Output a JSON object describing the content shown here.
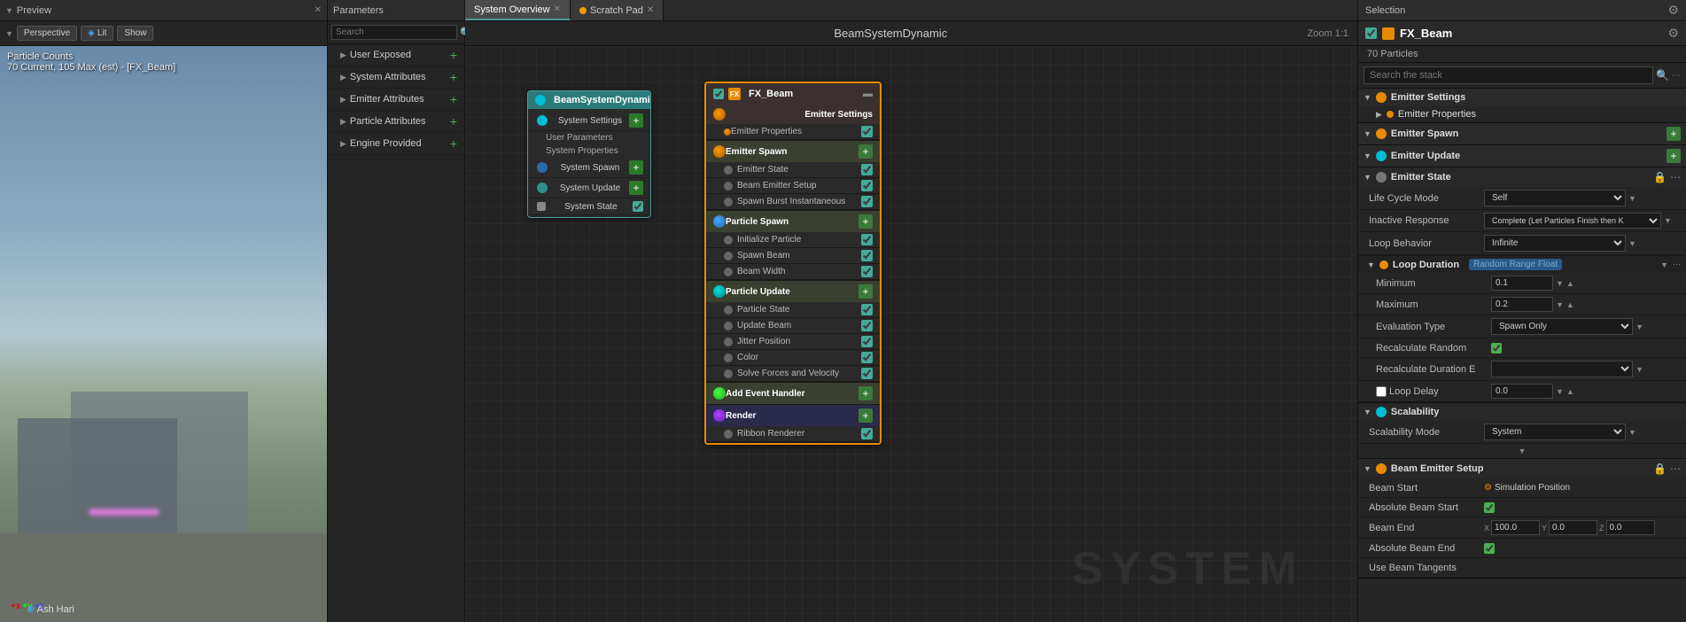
{
  "tabs": {
    "preview": "Preview",
    "parameters": "Parameters",
    "system_overview": "System Overview",
    "scratch_pad": "Scratch Pad",
    "selection": "Selection"
  },
  "preview": {
    "toolbar": {
      "perspective": "Perspective",
      "lit": "Lit",
      "show": "Show"
    },
    "overlay": {
      "particle_counts": "Particle Counts",
      "particles_info": "70 Current, 105 Max (est) - [FX_Beam]"
    },
    "username": "Ash Hari",
    "axis": {
      "x": "x",
      "y": "y",
      "z": "z"
    }
  },
  "params": {
    "search_placeholder": "Search",
    "items": [
      "User Exposed",
      "System Attributes",
      "Emitter Attributes",
      "Particle Attributes",
      "Engine Provided"
    ]
  },
  "center": {
    "title": "BeamSystemDynamic",
    "zoom": "Zoom 1:1",
    "watermark": "SYSTEM",
    "bsd_node": {
      "title": "BeamSystemDynamic",
      "sections": [
        "System Settings",
        "User Parameters",
        "System Properties",
        "System Spawn",
        "System Update",
        "System State"
      ]
    },
    "fxbeam_node": {
      "title": "FX_Beam",
      "emitter_settings": {
        "label": "Emitter Settings",
        "items": [
          "Emitter Properties"
        ]
      },
      "emitter_spawn": {
        "label": "Emitter Spawn",
        "items": [
          "Emitter State",
          "Beam Emitter Setup",
          "Spawn Burst Instantaneous"
        ]
      },
      "particle_spawn": {
        "label": "Particle Spawn",
        "items": [
          "Initialize Particle",
          "Spawn Beam",
          "Beam Width"
        ]
      },
      "particle_update": {
        "label": "Particle Update",
        "items": [
          "Particle State",
          "Update Beam",
          "Jitter Position",
          "Color",
          "Solve Forces and Velocity"
        ]
      },
      "add_event_handler": {
        "label": "Add Event Handler"
      },
      "render": {
        "label": "Render",
        "items": [
          "Ribbon Renderer"
        ]
      }
    }
  },
  "selection": {
    "title": "FX_Beam",
    "particle_count": "70 Particles",
    "search_placeholder": "Search the stack",
    "sections": {
      "emitter_settings": "Emitter Settings",
      "emitter_properties": "Emitter Properties",
      "emitter_spawn": "Emitter Spawn",
      "emitter_update": "Emitter Update",
      "emitter_state": "Emitter State",
      "beam_emitter_setup": "Beam Emitter Setup",
      "scalability": "Scalability"
    },
    "emitter_state": {
      "life_cycle_mode_label": "Life Cycle Mode",
      "life_cycle_mode_value": "Self",
      "inactive_response_label": "Inactive Response",
      "inactive_response_value": "Complete (Let Particles Finish then K",
      "loop_behavior_label": "Loop Behavior",
      "loop_behavior_value": "Infinite",
      "loop_duration_label": "Loop Duration",
      "loop_duration_badge": "Random Range Float",
      "minimum_label": "Minimum",
      "minimum_value": "0.1",
      "maximum_label": "Maximum",
      "maximum_value": "0.2",
      "evaluation_type_label": "Evaluation Type",
      "evaluation_type_value": "Spawn Only",
      "recalculate_random_label": "Recalculate Random",
      "recalculate_random_checked": true,
      "recalculate_duration_label": "Recalculate Duration E",
      "loop_delay_label": "Loop Delay",
      "loop_delay_value": "0.0"
    },
    "scalability": {
      "label": "Scalability",
      "scalability_mode_label": "Scalability Mode",
      "scalability_mode_value": "System"
    },
    "beam_setup": {
      "label": "Beam Emitter Setup",
      "beam_start_label": "Beam Start",
      "beam_start_value": "Simulation Position",
      "absolute_beam_start_label": "Absolute Beam Start",
      "beam_end_label": "Beam End",
      "beam_end_x": "X 100.0",
      "beam_end_y": "Y 0.0",
      "beam_end_z": "Z 0.0",
      "absolute_beam_end_label": "Absolute Beam End",
      "use_beam_tangents_label": "Use Beam Tangents"
    }
  }
}
